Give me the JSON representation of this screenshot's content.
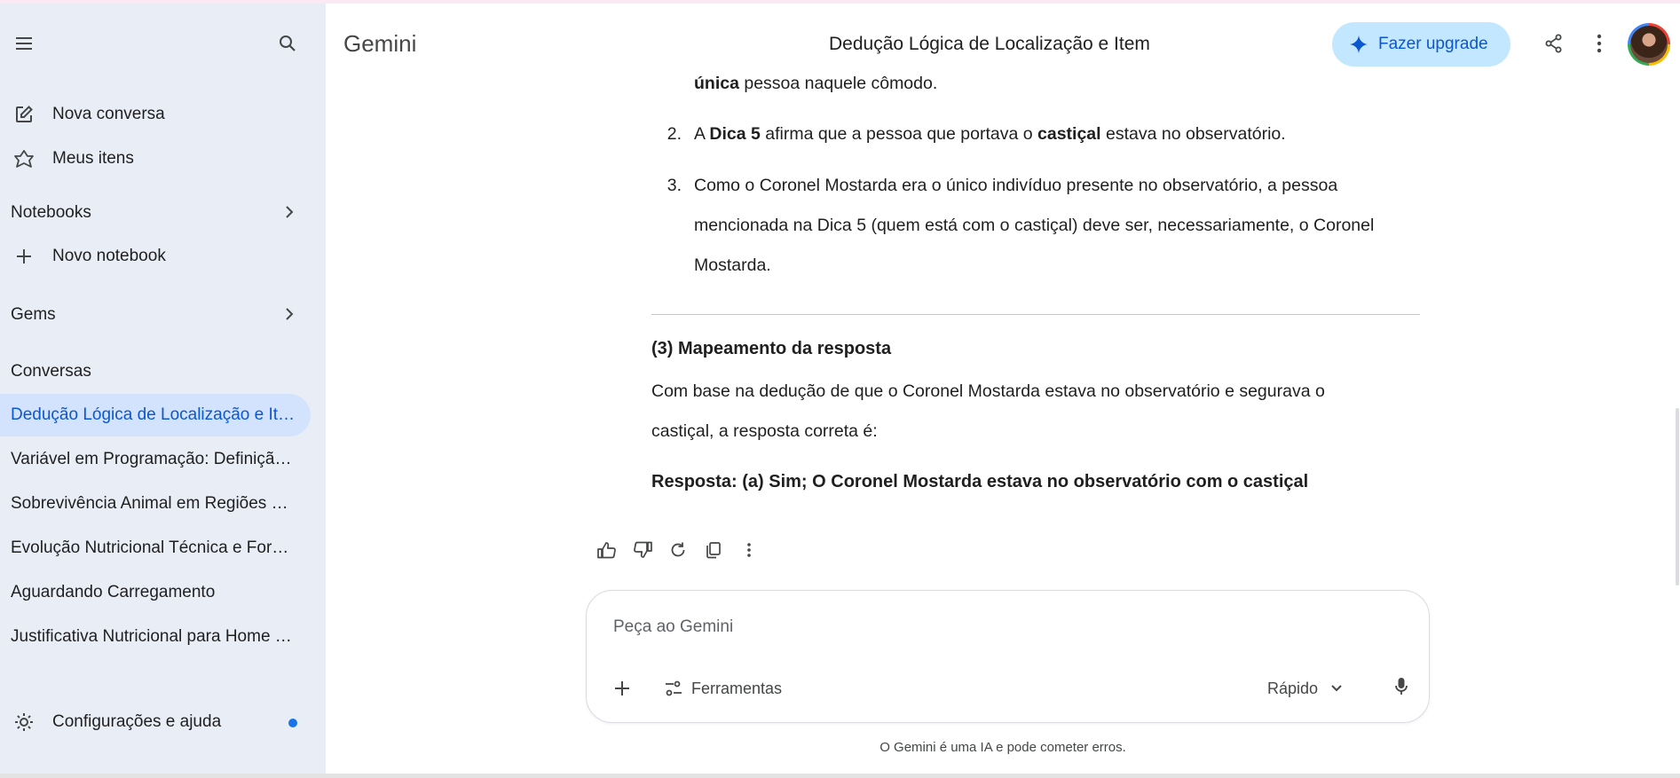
{
  "app": {
    "name": "Gemini"
  },
  "header": {
    "chat_title": "Dedução Lógica de Localização e Item",
    "upgrade_label": "Fazer upgrade"
  },
  "sidebar": {
    "new_chat": "Nova conversa",
    "my_items": "Meus itens",
    "notebooks_header": "Notebooks",
    "new_notebook": "Novo notebook",
    "gems_header": "Gems",
    "conversations_header": "Conversas",
    "conversations": [
      "Dedução Lógica de Localização e Item",
      "Variável em Programação: Definição ...",
      "Sobrevivência Animal em Regiões Gel...",
      "Evolução Nutricional Técnica e Formal",
      "Aguardando Carregamento",
      "Justificativa Nutricional para Home C..."
    ],
    "settings": "Configurações e ajuda"
  },
  "response": {
    "line0_bold": "única",
    "line0_rest": " pessoa naquele cômodo.",
    "item2_num": "2.",
    "item2_a": "A ",
    "item2_b1": "Dica 5",
    "item2_c": " afirma que a pessoa que portava o ",
    "item2_b2": "castiçal",
    "item2_d": " estava no observatório.",
    "item3_num": "3.",
    "item3_l1": "Como o Coronel Mostarda era o único indivíduo presente no observatório, a pessoa",
    "item3_l2": "mencionada na Dica 5 (quem está com o castiçal) deve ser, necessariamente, o Coronel",
    "item3_l3": "Mostarda.",
    "section_heading": "(3) Mapeamento da resposta",
    "body_l1": "Com base na dedução de que o Coronel Mostarda estava no observatório e segurava o",
    "body_l2": "castiçal, a resposta correta é:",
    "answer": "Resposta: (a) Sim; O Coronel Mostarda estava no observatório com o castiçal"
  },
  "composer": {
    "placeholder": "Peça ao Gemini",
    "tools_label": "Ferramentas",
    "mode_label": "Rápido"
  },
  "footer": {
    "disclaimer": "O Gemini é uma IA e pode cometer erros."
  },
  "icons": [
    "menu-icon",
    "search-icon",
    "edit-icon",
    "gem-icon",
    "chevron-right-icon",
    "plus-icon",
    "gear-icon",
    "spark-icon",
    "share-icon",
    "more-vert-icon",
    "thumb-up-icon",
    "thumb-down-icon",
    "refresh-icon",
    "copy-icon",
    "tune-icon",
    "chevron-down-icon",
    "mic-icon"
  ],
  "colors": {
    "sidebar_bg": "#e9eef6",
    "active_bg": "#d3e3fd",
    "accent": "#0b57d0",
    "upgrade_bg": "#c2e7ff"
  }
}
